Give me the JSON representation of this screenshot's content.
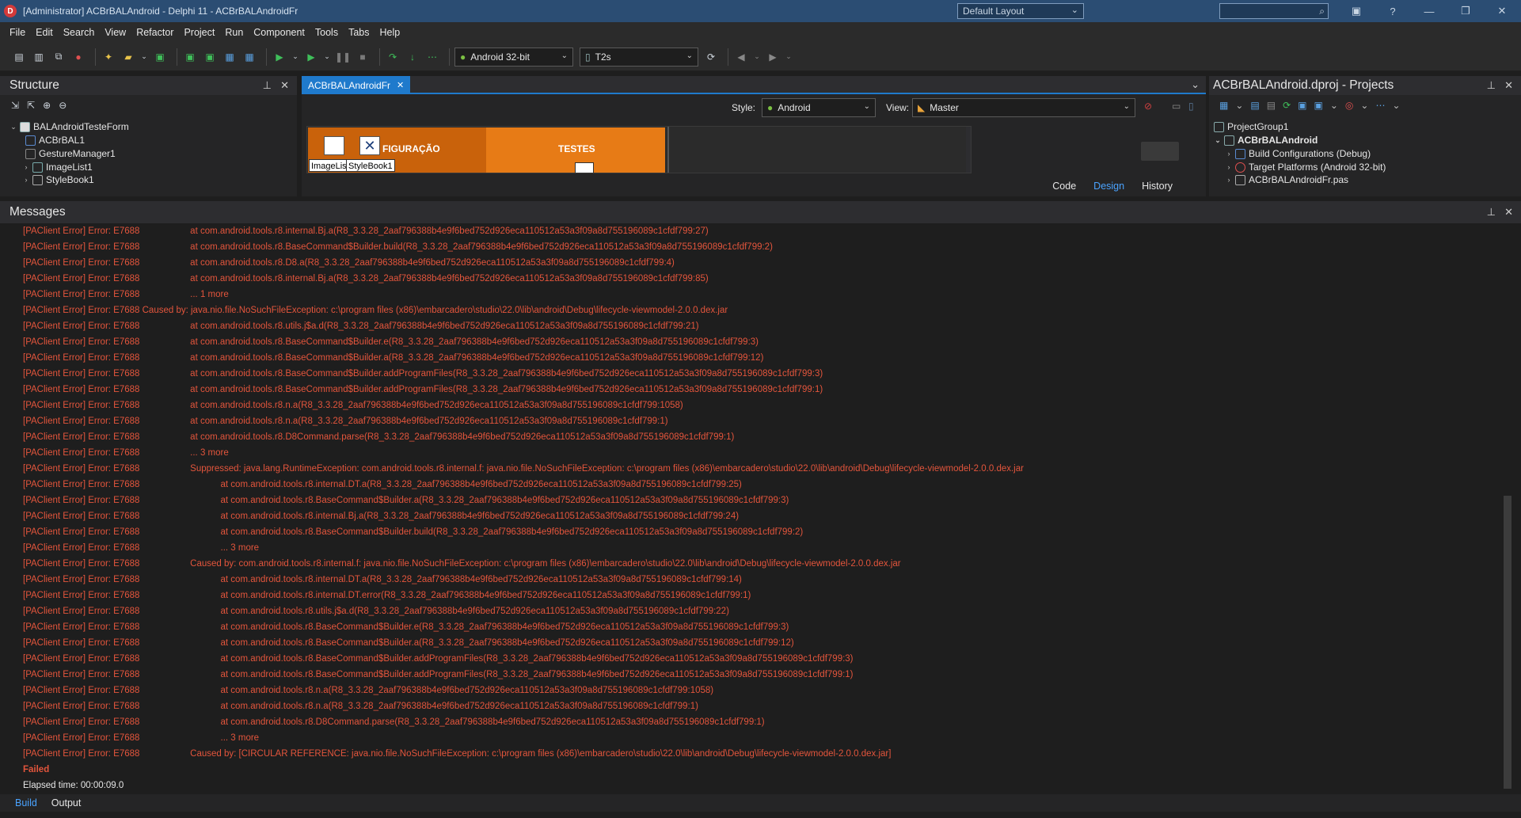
{
  "window": {
    "title": "[Administrator] ACBrBALAndroid - Delphi 11 - ACBrBALAndroidFr",
    "layout_combo": "Default Layout"
  },
  "menu": [
    "File",
    "Edit",
    "Search",
    "View",
    "Refactor",
    "Project",
    "Run",
    "Component",
    "Tools",
    "Tabs",
    "Help"
  ],
  "toolbar": {
    "platform": "Android 32-bit",
    "device": "T2s"
  },
  "structure": {
    "title": "Structure",
    "items": [
      {
        "label": "BALAndroidTesteForm"
      },
      {
        "label": "ACBrBAL1"
      },
      {
        "label": "GestureManager1"
      },
      {
        "label": "ImageList1"
      },
      {
        "label": "StyleBook1"
      }
    ]
  },
  "editor": {
    "tab": "ACBrBALAndroidFr",
    "style_label": "Style:",
    "style_value": "Android",
    "view_label": "View:",
    "view_value": "Master",
    "designer": {
      "band1": "FIGURAÇÃO",
      "band2": "TESTES",
      "comp1": "ImageLis",
      "comp2": "StyleBook1"
    },
    "bottom_tabs": [
      "Code",
      "Design",
      "History"
    ]
  },
  "projects": {
    "title": "ACBrBALAndroid.dproj - Projects",
    "items": [
      {
        "label": "ProjectGroup1"
      },
      {
        "label": "ACBrBALAndroid"
      },
      {
        "label": "Build Configurations (Debug)"
      },
      {
        "label": "Target Platforms (Android 32-bit)"
      },
      {
        "label": "ACBrBALAndroidFr.pas"
      }
    ]
  },
  "messages": {
    "title": "Messages",
    "lines": [
      {
        "p": "[PAClient Error] Error: E7688",
        "t": "      at com.android.tools.r8.internal.Bj.a(R8_3.3.28_2aaf796388b4e9f6bed752d926eca110512a53a3f09a8d755196089c1cfdf799:27)"
      },
      {
        "p": "[PAClient Error] Error: E7688",
        "t": "      at com.android.tools.r8.BaseCommand$Builder.build(R8_3.3.28_2aaf796388b4e9f6bed752d926eca110512a53a3f09a8d755196089c1cfdf799:2)"
      },
      {
        "p": "[PAClient Error] Error: E7688",
        "t": "      at com.android.tools.r8.D8.a(R8_3.3.28_2aaf796388b4e9f6bed752d926eca110512a53a3f09a8d755196089c1cfdf799:4)"
      },
      {
        "p": "[PAClient Error] Error: E7688",
        "t": "      at com.android.tools.r8.internal.Bj.a(R8_3.3.28_2aaf796388b4e9f6bed752d926eca110512a53a3f09a8d755196089c1cfdf799:85)"
      },
      {
        "p": "[PAClient Error] Error: E7688",
        "t": "      ... 1 more"
      },
      {
        "p": "[PAClient Error] Error: E7688",
        "t": "Caused by: java.nio.file.NoSuchFileException: c:\\program files (x86)\\embarcadero\\studio\\22.0\\lib\\android\\Debug\\lifecycle-viewmodel-2.0.0.dex.jar",
        "inline": true
      },
      {
        "p": "[PAClient Error] Error: E7688",
        "t": "      at com.android.tools.r8.utils.j$a.d(R8_3.3.28_2aaf796388b4e9f6bed752d926eca110512a53a3f09a8d755196089c1cfdf799:21)"
      },
      {
        "p": "[PAClient Error] Error: E7688",
        "t": "      at com.android.tools.r8.BaseCommand$Builder.e(R8_3.3.28_2aaf796388b4e9f6bed752d926eca110512a53a3f09a8d755196089c1cfdf799:3)"
      },
      {
        "p": "[PAClient Error] Error: E7688",
        "t": "      at com.android.tools.r8.BaseCommand$Builder.a(R8_3.3.28_2aaf796388b4e9f6bed752d926eca110512a53a3f09a8d755196089c1cfdf799:12)"
      },
      {
        "p": "[PAClient Error] Error: E7688",
        "t": "      at com.android.tools.r8.BaseCommand$Builder.addProgramFiles(R8_3.3.28_2aaf796388b4e9f6bed752d926eca110512a53a3f09a8d755196089c1cfdf799:3)"
      },
      {
        "p": "[PAClient Error] Error: E7688",
        "t": "      at com.android.tools.r8.BaseCommand$Builder.addProgramFiles(R8_3.3.28_2aaf796388b4e9f6bed752d926eca110512a53a3f09a8d755196089c1cfdf799:1)"
      },
      {
        "p": "[PAClient Error] Error: E7688",
        "t": "      at com.android.tools.r8.n.a(R8_3.3.28_2aaf796388b4e9f6bed752d926eca110512a53a3f09a8d755196089c1cfdf799:1058)"
      },
      {
        "p": "[PAClient Error] Error: E7688",
        "t": "      at com.android.tools.r8.n.a(R8_3.3.28_2aaf796388b4e9f6bed752d926eca110512a53a3f09a8d755196089c1cfdf799:1)"
      },
      {
        "p": "[PAClient Error] Error: E7688",
        "t": "      at com.android.tools.r8.D8Command.parse(R8_3.3.28_2aaf796388b4e9f6bed752d926eca110512a53a3f09a8d755196089c1cfdf799:1)"
      },
      {
        "p": "[PAClient Error] Error: E7688",
        "t": "      ... 3 more"
      },
      {
        "p": "[PAClient Error] Error: E7688",
        "t": "      Suppressed: java.lang.RuntimeException: com.android.tools.r8.internal.f: java.nio.file.NoSuchFileException: c:\\program files (x86)\\embarcadero\\studio\\22.0\\lib\\android\\Debug\\lifecycle-viewmodel-2.0.0.dex.jar"
      },
      {
        "p": "[PAClient Error] Error: E7688",
        "t": "                  at com.android.tools.r8.internal.DT.a(R8_3.3.28_2aaf796388b4e9f6bed752d926eca110512a53a3f09a8d755196089c1cfdf799:25)"
      },
      {
        "p": "[PAClient Error] Error: E7688",
        "t": "                  at com.android.tools.r8.BaseCommand$Builder.a(R8_3.3.28_2aaf796388b4e9f6bed752d926eca110512a53a3f09a8d755196089c1cfdf799:3)"
      },
      {
        "p": "[PAClient Error] Error: E7688",
        "t": "                  at com.android.tools.r8.internal.Bj.a(R8_3.3.28_2aaf796388b4e9f6bed752d926eca110512a53a3f09a8d755196089c1cfdf799:24)"
      },
      {
        "p": "[PAClient Error] Error: E7688",
        "t": "                  at com.android.tools.r8.BaseCommand$Builder.build(R8_3.3.28_2aaf796388b4e9f6bed752d926eca110512a53a3f09a8d755196089c1cfdf799:2)"
      },
      {
        "p": "[PAClient Error] Error: E7688",
        "t": "                  ... 3 more"
      },
      {
        "p": "[PAClient Error] Error: E7688",
        "t": "      Caused by: com.android.tools.r8.internal.f: java.nio.file.NoSuchFileException: c:\\program files (x86)\\embarcadero\\studio\\22.0\\lib\\android\\Debug\\lifecycle-viewmodel-2.0.0.dex.jar"
      },
      {
        "p": "[PAClient Error] Error: E7688",
        "t": "                  at com.android.tools.r8.internal.DT.a(R8_3.3.28_2aaf796388b4e9f6bed752d926eca110512a53a3f09a8d755196089c1cfdf799:14)"
      },
      {
        "p": "[PAClient Error] Error: E7688",
        "t": "                  at com.android.tools.r8.internal.DT.error(R8_3.3.28_2aaf796388b4e9f6bed752d926eca110512a53a3f09a8d755196089c1cfdf799:1)"
      },
      {
        "p": "[PAClient Error] Error: E7688",
        "t": "                  at com.android.tools.r8.utils.j$a.d(R8_3.3.28_2aaf796388b4e9f6bed752d926eca110512a53a3f09a8d755196089c1cfdf799:22)"
      },
      {
        "p": "[PAClient Error] Error: E7688",
        "t": "                  at com.android.tools.r8.BaseCommand$Builder.e(R8_3.3.28_2aaf796388b4e9f6bed752d926eca110512a53a3f09a8d755196089c1cfdf799:3)"
      },
      {
        "p": "[PAClient Error] Error: E7688",
        "t": "                  at com.android.tools.r8.BaseCommand$Builder.a(R8_3.3.28_2aaf796388b4e9f6bed752d926eca110512a53a3f09a8d755196089c1cfdf799:12)"
      },
      {
        "p": "[PAClient Error] Error: E7688",
        "t": "                  at com.android.tools.r8.BaseCommand$Builder.addProgramFiles(R8_3.3.28_2aaf796388b4e9f6bed752d926eca110512a53a3f09a8d755196089c1cfdf799:3)"
      },
      {
        "p": "[PAClient Error] Error: E7688",
        "t": "                  at com.android.tools.r8.BaseCommand$Builder.addProgramFiles(R8_3.3.28_2aaf796388b4e9f6bed752d926eca110512a53a3f09a8d755196089c1cfdf799:1)"
      },
      {
        "p": "[PAClient Error] Error: E7688",
        "t": "                  at com.android.tools.r8.n.a(R8_3.3.28_2aaf796388b4e9f6bed752d926eca110512a53a3f09a8d755196089c1cfdf799:1058)"
      },
      {
        "p": "[PAClient Error] Error: E7688",
        "t": "                  at com.android.tools.r8.n.a(R8_3.3.28_2aaf796388b4e9f6bed752d926eca110512a53a3f09a8d755196089c1cfdf799:1)"
      },
      {
        "p": "[PAClient Error] Error: E7688",
        "t": "                  at com.android.tools.r8.D8Command.parse(R8_3.3.28_2aaf796388b4e9f6bed752d926eca110512a53a3f09a8d755196089c1cfdf799:1)"
      },
      {
        "p": "[PAClient Error] Error: E7688",
        "t": "                  ... 3 more"
      },
      {
        "p": "[PAClient Error] Error: E7688",
        "t": "      Caused by: [CIRCULAR REFERENCE: java.nio.file.NoSuchFileException: c:\\program files (x86)\\embarcadero\\studio\\22.0\\lib\\android\\Debug\\lifecycle-viewmodel-2.0.0.dex.jar]"
      }
    ],
    "failed": "Failed",
    "elapsed": "Elapsed time: 00:00:09.0",
    "tabs": [
      "Build",
      "Output"
    ]
  }
}
